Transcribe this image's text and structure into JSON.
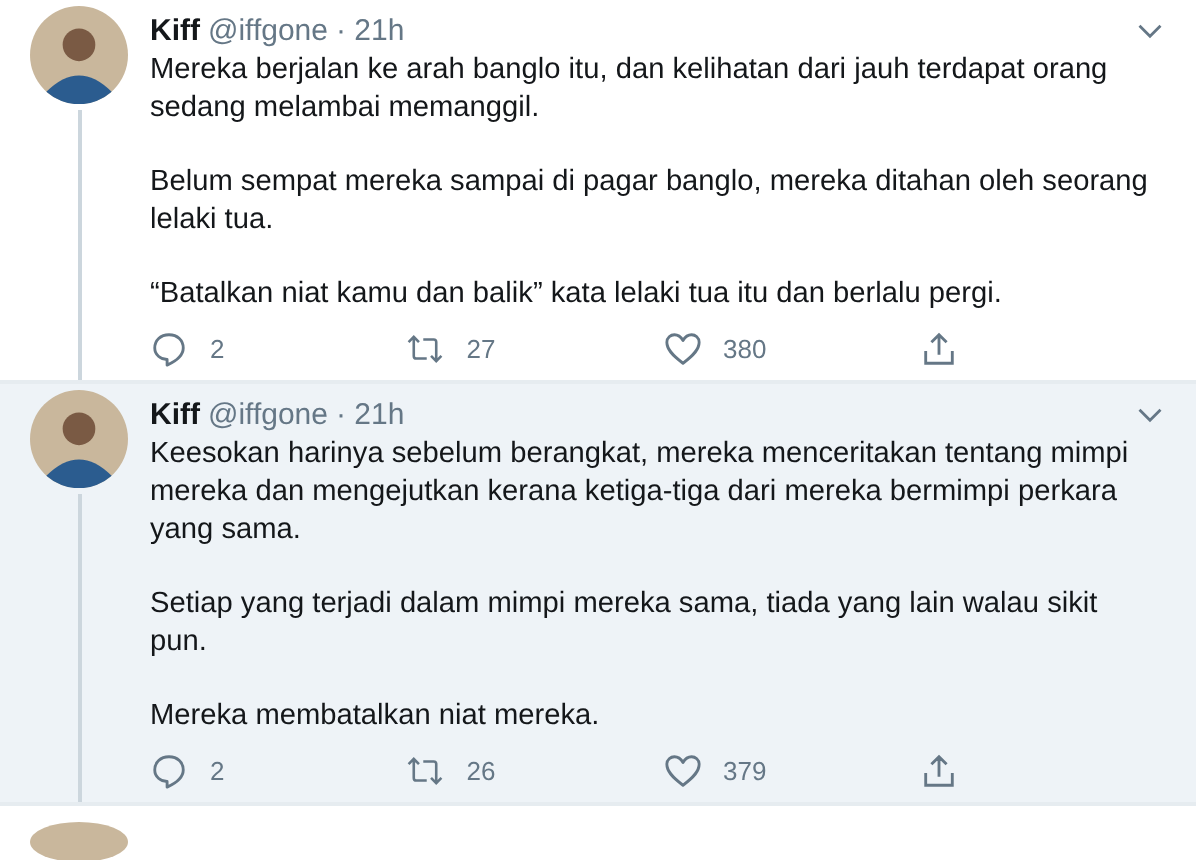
{
  "tweets": [
    {
      "name": "Kiff",
      "handle": "@iffgone",
      "time": "· 21h",
      "highlighted": false,
      "thread_line": true,
      "paragraphs": [
        "Mereka berjalan ke arah banglo itu, dan kelihatan dari jauh terdapat orang sedang melambai memanggil.",
        "Belum sempat mereka sampai di pagar banglo, mereka ditahan oleh seorang lelaki tua.",
        "“Batalkan niat kamu dan balik” kata lelaki tua itu dan berlalu pergi."
      ],
      "replies": "2",
      "retweets": "27",
      "likes": "380"
    },
    {
      "name": "Kiff",
      "handle": "@iffgone",
      "time": "· 21h",
      "highlighted": true,
      "thread_line": true,
      "paragraphs": [
        "Keesokan harinya sebelum berangkat, mereka menceritakan tentang mimpi mereka dan mengejutkan kerana ketiga-tiga dari mereka bermimpi perkara yang sama.",
        "Setiap yang terjadi dalam mimpi mereka sama, tiada yang lain walau sikit pun.",
        "Mereka membatalkan niat mereka."
      ],
      "replies": "2",
      "retweets": "26",
      "likes": "379"
    }
  ]
}
